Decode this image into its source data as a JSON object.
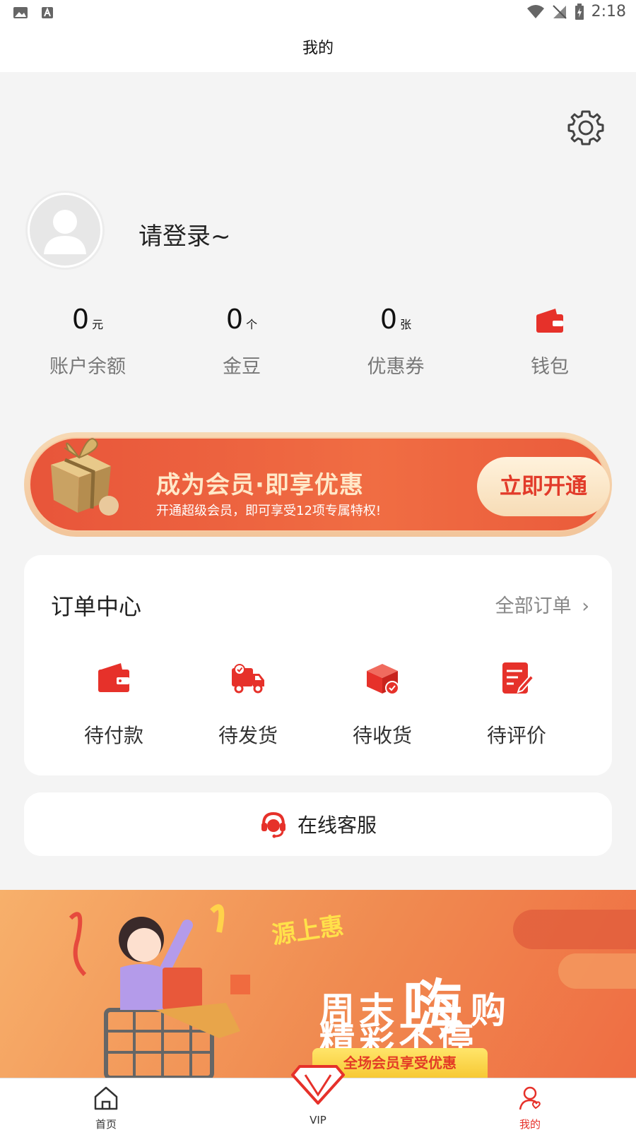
{
  "status_bar": {
    "time": "2:18"
  },
  "header": {
    "title": "我的"
  },
  "profile": {
    "login_prompt": "请登录~"
  },
  "stats": [
    {
      "value": "0",
      "unit": "元",
      "label": "账户余额"
    },
    {
      "value": "0",
      "unit": "个",
      "label": "金豆"
    },
    {
      "value": "0",
      "unit": "张",
      "label": "优惠券"
    }
  ],
  "wallet": {
    "label": "钱包"
  },
  "vip_banner": {
    "title": "成为会员·即享优惠",
    "subtitle": "开通超级会员，即可享受12项专属特权!",
    "button": "立即开通"
  },
  "orders": {
    "title": "订单中心",
    "all_link": "全部订单",
    "items": [
      {
        "label": "待付款",
        "icon": "wallet-icon"
      },
      {
        "label": "待发货",
        "icon": "truck-icon"
      },
      {
        "label": "待收货",
        "icon": "box-icon"
      },
      {
        "label": "待评价",
        "icon": "review-icon"
      }
    ]
  },
  "customer_service": {
    "label": "在线客服",
    "icon": "headset-icon"
  },
  "promo": {
    "brand": "源上惠",
    "line1_a": "周末",
    "line1_b": "嗨",
    "line1_c": "购",
    "line2": "精彩不停",
    "badge": "全场会员享受优惠"
  },
  "tabbar": {
    "tabs": [
      {
        "label": "首页",
        "icon": "home-icon"
      },
      {
        "label": "VIP",
        "icon": "diamond-icon"
      },
      {
        "label": "我的",
        "icon": "profile-icon",
        "active": true
      }
    ]
  },
  "colors": {
    "accent": "#e6312a",
    "banner": "#ec5e3e"
  }
}
